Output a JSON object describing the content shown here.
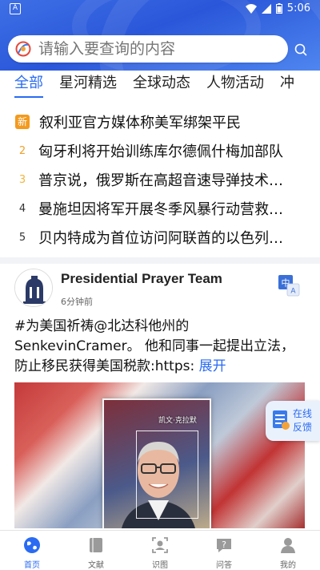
{
  "status": {
    "time": "5:06",
    "left_icon_letter": "A"
  },
  "search": {
    "placeholder": "请输入要查询的内容",
    "logo_icon": "search-logo-icon",
    "button_icon": "search-icon"
  },
  "tabs": [
    {
      "label": "全部",
      "active": true
    },
    {
      "label": "星河精选",
      "active": false
    },
    {
      "label": "全球动态",
      "active": false
    },
    {
      "label": "人物活动",
      "active": false
    },
    {
      "label": "冲",
      "active": false
    }
  ],
  "hot_list": [
    {
      "rank": "新",
      "text": "叙利亚官方媒体称美军绑架平民"
    },
    {
      "rank": "2",
      "text": "匈牙利将开始训练库尔德佩什梅加部队"
    },
    {
      "rank": "3",
      "text": "普京说，俄罗斯在高超音速导弹技术…"
    },
    {
      "rank": "4",
      "text": "曼施坦因将军开展冬季风暴行动营救…"
    },
    {
      "rank": "5",
      "text": "贝内特成为首位访问阿联酋的以色列…"
    }
  ],
  "colors": {
    "accent": "#2a6bf2",
    "rank_new": "#f39a1e",
    "rank_2": "#f0a02a",
    "rank_3": "#f2b53a",
    "rank_default": "#333333"
  },
  "post": {
    "author": "Presidential Prayer Team",
    "time": "6分钟前",
    "text": "#为美国祈祷@北达科他州的SenkevinCramer。 他和同事一起提出立法，防止移民获得美国税款:https: ",
    "expand_label": "展开",
    "face_label": "凯文·克拉默",
    "translate_icon": "translate-icon"
  },
  "feedback": {
    "label": "在线反馈"
  },
  "bottom_nav": [
    {
      "label": "首页",
      "icon": "globe-icon",
      "active": true
    },
    {
      "label": "文献",
      "icon": "book-icon",
      "active": false
    },
    {
      "label": "识图",
      "icon": "face-scan-icon",
      "active": false
    },
    {
      "label": "问答",
      "icon": "question-icon",
      "active": false
    },
    {
      "label": "我的",
      "icon": "user-icon",
      "active": false
    }
  ]
}
